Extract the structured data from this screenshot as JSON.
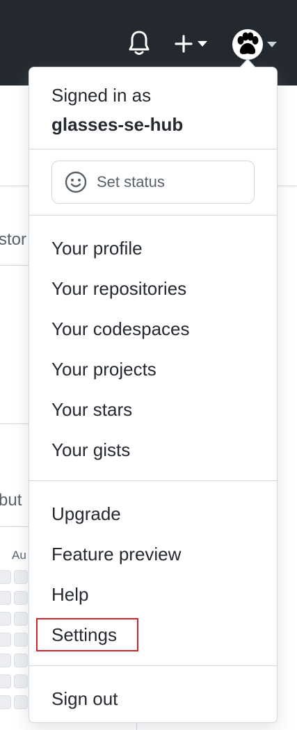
{
  "header": {
    "notifications_icon": "bell-icon",
    "create_icon": "plus-icon",
    "avatar_icon": "paw-avatar-icon",
    "background_color": "#24292f"
  },
  "background_page": {
    "fragments": [
      "stor",
      "but",
      "Au"
    ]
  },
  "dropdown": {
    "signed_in_label": "Signed in as",
    "username": "glasses-se-hub",
    "status_button": {
      "icon": "smiley-icon",
      "label": "Set status"
    },
    "profile_items": [
      {
        "label": "Your profile"
      },
      {
        "label": "Your repositories"
      },
      {
        "label": "Your codespaces"
      },
      {
        "label": "Your projects"
      },
      {
        "label": "Your stars"
      },
      {
        "label": "Your gists"
      }
    ],
    "account_items": [
      {
        "label": "Upgrade"
      },
      {
        "label": "Feature preview"
      },
      {
        "label": "Help"
      },
      {
        "label": "Settings",
        "highlighted": true
      }
    ],
    "sign_out_label": "Sign out",
    "highlight_color": "#d1242f"
  }
}
